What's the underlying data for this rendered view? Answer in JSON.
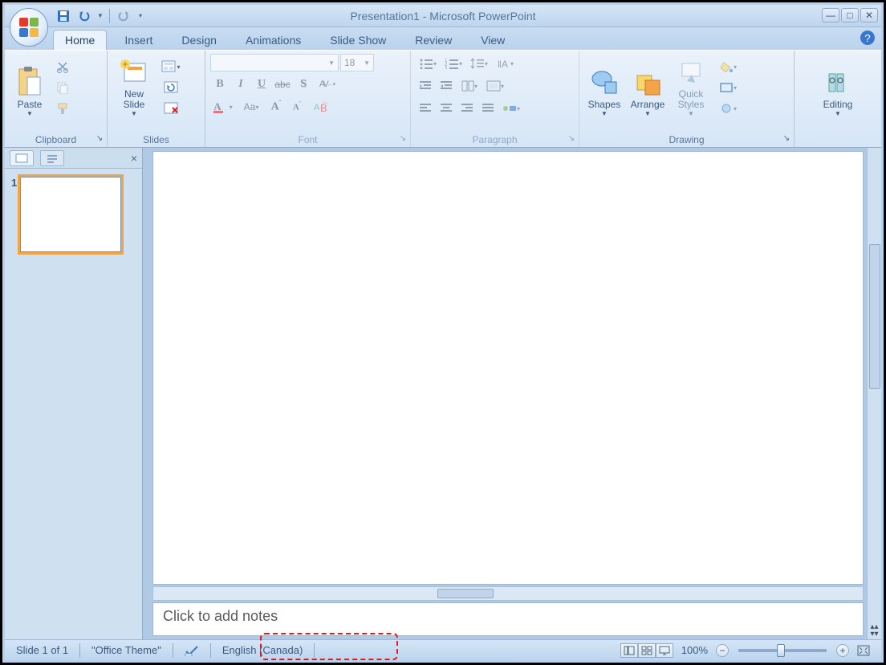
{
  "title": "Presentation1 - Microsoft PowerPoint",
  "tabs": [
    "Home",
    "Insert",
    "Design",
    "Animations",
    "Slide Show",
    "Review",
    "View"
  ],
  "active_tab": "Home",
  "ribbon": {
    "clipboard": {
      "label": "Clipboard",
      "paste": "Paste"
    },
    "slides": {
      "label": "Slides",
      "new_slide": "New\nSlide"
    },
    "font": {
      "label": "Font",
      "size": "18"
    },
    "paragraph": {
      "label": "Paragraph"
    },
    "drawing": {
      "label": "Drawing",
      "shapes": "Shapes",
      "arrange": "Arrange",
      "quick_styles": "Quick\nStyles"
    },
    "editing": {
      "label": "Editing"
    }
  },
  "thumb_number": "1",
  "notes_placeholder": "Click to add notes",
  "status": {
    "slide": "Slide 1 of 1",
    "theme": "\"Office Theme\"",
    "language": "English (Canada)",
    "zoom": "100%"
  }
}
